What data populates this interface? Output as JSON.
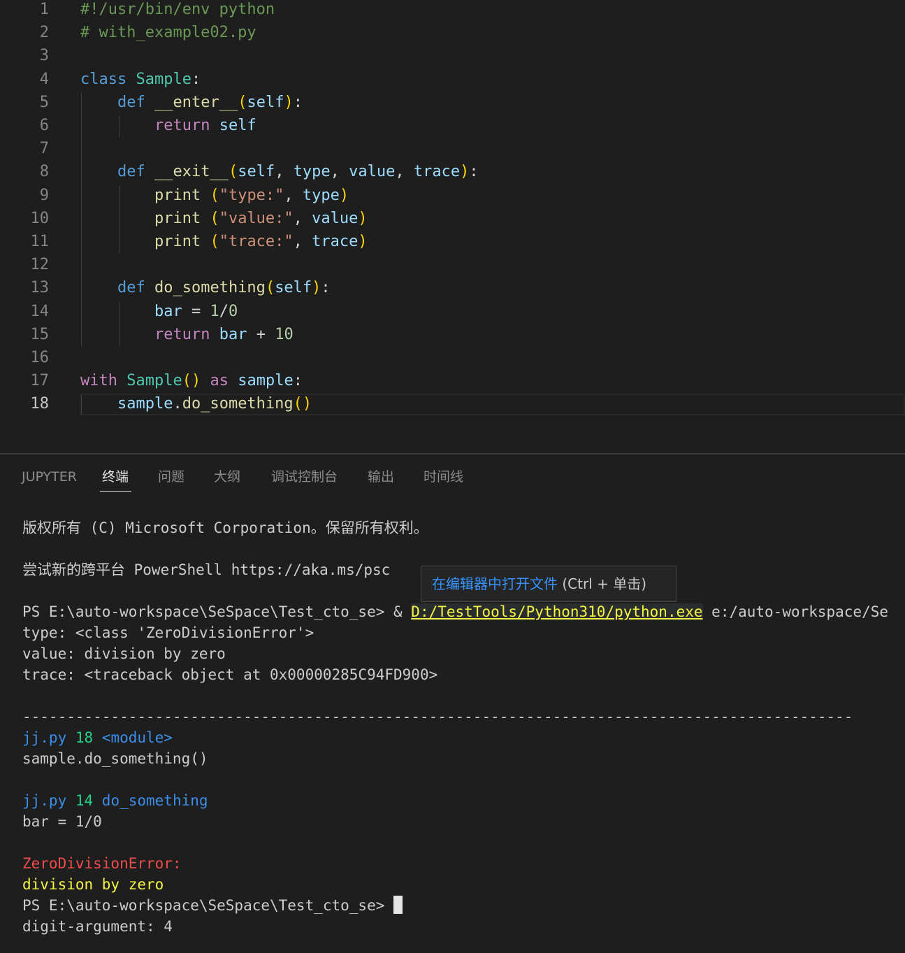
{
  "editor": {
    "active_line": "18",
    "lines": [
      {
        "num": "1",
        "tokens": [
          {
            "t": "#!/usr/bin/env python",
            "c": "k-com"
          }
        ]
      },
      {
        "num": "2",
        "tokens": [
          {
            "t": "# with_example02.py",
            "c": "k-com"
          }
        ]
      },
      {
        "num": "3",
        "tokens": []
      },
      {
        "num": "4",
        "tokens": [
          {
            "t": "class",
            "c": "k-kw"
          },
          {
            "t": " ",
            "c": "k-pl"
          },
          {
            "t": "Sample",
            "c": "k-cls"
          },
          {
            "t": ":",
            "c": "k-pl"
          }
        ]
      },
      {
        "num": "5",
        "tokens": [
          {
            "t": "    ",
            "c": "k-pl"
          },
          {
            "t": "def",
            "c": "k-kw"
          },
          {
            "t": " ",
            "c": "k-pl"
          },
          {
            "t": "__enter__",
            "c": "k-fn"
          },
          {
            "t": "(",
            "c": "k-br1"
          },
          {
            "t": "self",
            "c": "k-var"
          },
          {
            "t": ")",
            "c": "k-br1"
          },
          {
            "t": ":",
            "c": "k-pl"
          }
        ]
      },
      {
        "num": "6",
        "tokens": [
          {
            "t": "        ",
            "c": "k-pl"
          },
          {
            "t": "return",
            "c": "k-ctl"
          },
          {
            "t": " ",
            "c": "k-pl"
          },
          {
            "t": "self",
            "c": "k-var"
          }
        ]
      },
      {
        "num": "7",
        "tokens": []
      },
      {
        "num": "8",
        "tokens": [
          {
            "t": "    ",
            "c": "k-pl"
          },
          {
            "t": "def",
            "c": "k-kw"
          },
          {
            "t": " ",
            "c": "k-pl"
          },
          {
            "t": "__exit__",
            "c": "k-fn"
          },
          {
            "t": "(",
            "c": "k-br1"
          },
          {
            "t": "self",
            "c": "k-var"
          },
          {
            "t": ", ",
            "c": "k-pl"
          },
          {
            "t": "type",
            "c": "k-var"
          },
          {
            "t": ", ",
            "c": "k-pl"
          },
          {
            "t": "value",
            "c": "k-var"
          },
          {
            "t": ", ",
            "c": "k-pl"
          },
          {
            "t": "trace",
            "c": "k-var"
          },
          {
            "t": ")",
            "c": "k-br1"
          },
          {
            "t": ":",
            "c": "k-pl"
          }
        ]
      },
      {
        "num": "9",
        "tokens": [
          {
            "t": "        ",
            "c": "k-pl"
          },
          {
            "t": "print",
            "c": "k-fn"
          },
          {
            "t": " ",
            "c": "k-pl"
          },
          {
            "t": "(",
            "c": "k-br1"
          },
          {
            "t": "\"type:\"",
            "c": "k-str"
          },
          {
            "t": ", ",
            "c": "k-pl"
          },
          {
            "t": "type",
            "c": "k-var"
          },
          {
            "t": ")",
            "c": "k-br1"
          }
        ]
      },
      {
        "num": "10",
        "tokens": [
          {
            "t": "        ",
            "c": "k-pl"
          },
          {
            "t": "print",
            "c": "k-fn"
          },
          {
            "t": " ",
            "c": "k-pl"
          },
          {
            "t": "(",
            "c": "k-br1"
          },
          {
            "t": "\"value:\"",
            "c": "k-str"
          },
          {
            "t": ", ",
            "c": "k-pl"
          },
          {
            "t": "value",
            "c": "k-var"
          },
          {
            "t": ")",
            "c": "k-br1"
          }
        ]
      },
      {
        "num": "11",
        "tokens": [
          {
            "t": "        ",
            "c": "k-pl"
          },
          {
            "t": "print",
            "c": "k-fn"
          },
          {
            "t": " ",
            "c": "k-pl"
          },
          {
            "t": "(",
            "c": "k-br1"
          },
          {
            "t": "\"trace:\"",
            "c": "k-str"
          },
          {
            "t": ", ",
            "c": "k-pl"
          },
          {
            "t": "trace",
            "c": "k-var"
          },
          {
            "t": ")",
            "c": "k-br1"
          }
        ]
      },
      {
        "num": "12",
        "tokens": []
      },
      {
        "num": "13",
        "tokens": [
          {
            "t": "    ",
            "c": "k-pl"
          },
          {
            "t": "def",
            "c": "k-kw"
          },
          {
            "t": " ",
            "c": "k-pl"
          },
          {
            "t": "do_something",
            "c": "k-fn"
          },
          {
            "t": "(",
            "c": "k-br1"
          },
          {
            "t": "self",
            "c": "k-var"
          },
          {
            "t": ")",
            "c": "k-br1"
          },
          {
            "t": ":",
            "c": "k-pl"
          }
        ]
      },
      {
        "num": "14",
        "tokens": [
          {
            "t": "        ",
            "c": "k-pl"
          },
          {
            "t": "bar",
            "c": "k-var"
          },
          {
            "t": " = ",
            "c": "k-pl"
          },
          {
            "t": "1",
            "c": "k-num"
          },
          {
            "t": "/",
            "c": "k-pl"
          },
          {
            "t": "0",
            "c": "k-num"
          }
        ]
      },
      {
        "num": "15",
        "tokens": [
          {
            "t": "        ",
            "c": "k-pl"
          },
          {
            "t": "return",
            "c": "k-ctl"
          },
          {
            "t": " ",
            "c": "k-pl"
          },
          {
            "t": "bar",
            "c": "k-var"
          },
          {
            "t": " + ",
            "c": "k-pl"
          },
          {
            "t": "10",
            "c": "k-num"
          }
        ]
      },
      {
        "num": "16",
        "tokens": []
      },
      {
        "num": "17",
        "tokens": [
          {
            "t": "with",
            "c": "k-ctl"
          },
          {
            "t": " ",
            "c": "k-pl"
          },
          {
            "t": "Sample",
            "c": "k-cls"
          },
          {
            "t": "()",
            "c": "k-br1"
          },
          {
            "t": " ",
            "c": "k-pl"
          },
          {
            "t": "as",
            "c": "k-ctl"
          },
          {
            "t": " ",
            "c": "k-pl"
          },
          {
            "t": "sample",
            "c": "k-var"
          },
          {
            "t": ":",
            "c": "k-pl"
          }
        ]
      },
      {
        "num": "18",
        "tokens": [
          {
            "t": "    ",
            "c": "k-pl"
          },
          {
            "t": "sample",
            "c": "k-var"
          },
          {
            "t": ".",
            "c": "k-pl"
          },
          {
            "t": "do_something",
            "c": "k-fn"
          },
          {
            "t": "()",
            "c": "k-br1"
          }
        ]
      }
    ]
  },
  "panel": {
    "tabs": [
      {
        "label": "JUPYTER",
        "active": false
      },
      {
        "label": "终端",
        "active": true
      },
      {
        "label": "问题",
        "active": false
      },
      {
        "label": "大纲",
        "active": false
      },
      {
        "label": "调试控制台",
        "active": false
      },
      {
        "label": "输出",
        "active": false
      },
      {
        "label": "时间线",
        "active": false
      }
    ]
  },
  "terminal": {
    "lines": [
      [
        {
          "t": "版权所有 (C) Microsoft Corporation。保留所有权利。",
          "c": ""
        }
      ],
      [],
      [
        {
          "t": "尝试新的跨平台 PowerShell https://aka.ms/psc",
          "c": ""
        }
      ],
      [],
      [
        {
          "t": "PS E:\\auto-workspace\\SeSpace\\Test_cto_se> & ",
          "c": ""
        },
        {
          "t": "D:/TestTools/Python310/python.exe",
          "c": "t-link"
        },
        {
          "t": " e:/auto-workspace/Se",
          "c": ""
        }
      ],
      [
        {
          "t": "type: <class 'ZeroDivisionError'>",
          "c": ""
        }
      ],
      [
        {
          "t": "value: division by zero",
          "c": ""
        }
      ],
      [
        {
          "t": "trace: <traceback object at 0x00000285C94FD900>",
          "c": ""
        }
      ],
      [],
      [
        {
          "t": "----------------------------------------------------------------------------------------------",
          "c": ""
        }
      ],
      [
        {
          "t": "jj.py",
          "c": "t-cyan"
        },
        {
          "t": " 18 ",
          "c": "t-green"
        },
        {
          "t": "<module>",
          "c": "t-cyan"
        }
      ],
      [
        {
          "t": "sample.do_something()",
          "c": ""
        }
      ],
      [],
      [
        {
          "t": "jj.py",
          "c": "t-cyan"
        },
        {
          "t": " 14 ",
          "c": "t-green"
        },
        {
          "t": "do_something",
          "c": "t-cyan"
        }
      ],
      [
        {
          "t": "bar = 1/0",
          "c": ""
        }
      ],
      [],
      [
        {
          "t": "ZeroDivisionError:",
          "c": "t-red"
        }
      ],
      [
        {
          "t": "division by zero",
          "c": "t-yellow"
        }
      ],
      [
        {
          "t": "PS E:\\auto-workspace\\SeSpace\\Test_cto_se> ",
          "c": ""
        },
        {
          "cursor": true
        }
      ],
      [
        {
          "t": "digit-argument: 4",
          "c": ""
        }
      ]
    ],
    "tooltip": {
      "link_text": "在编辑器中打开文件",
      "hint_text": " (Ctrl + 单击)"
    }
  }
}
